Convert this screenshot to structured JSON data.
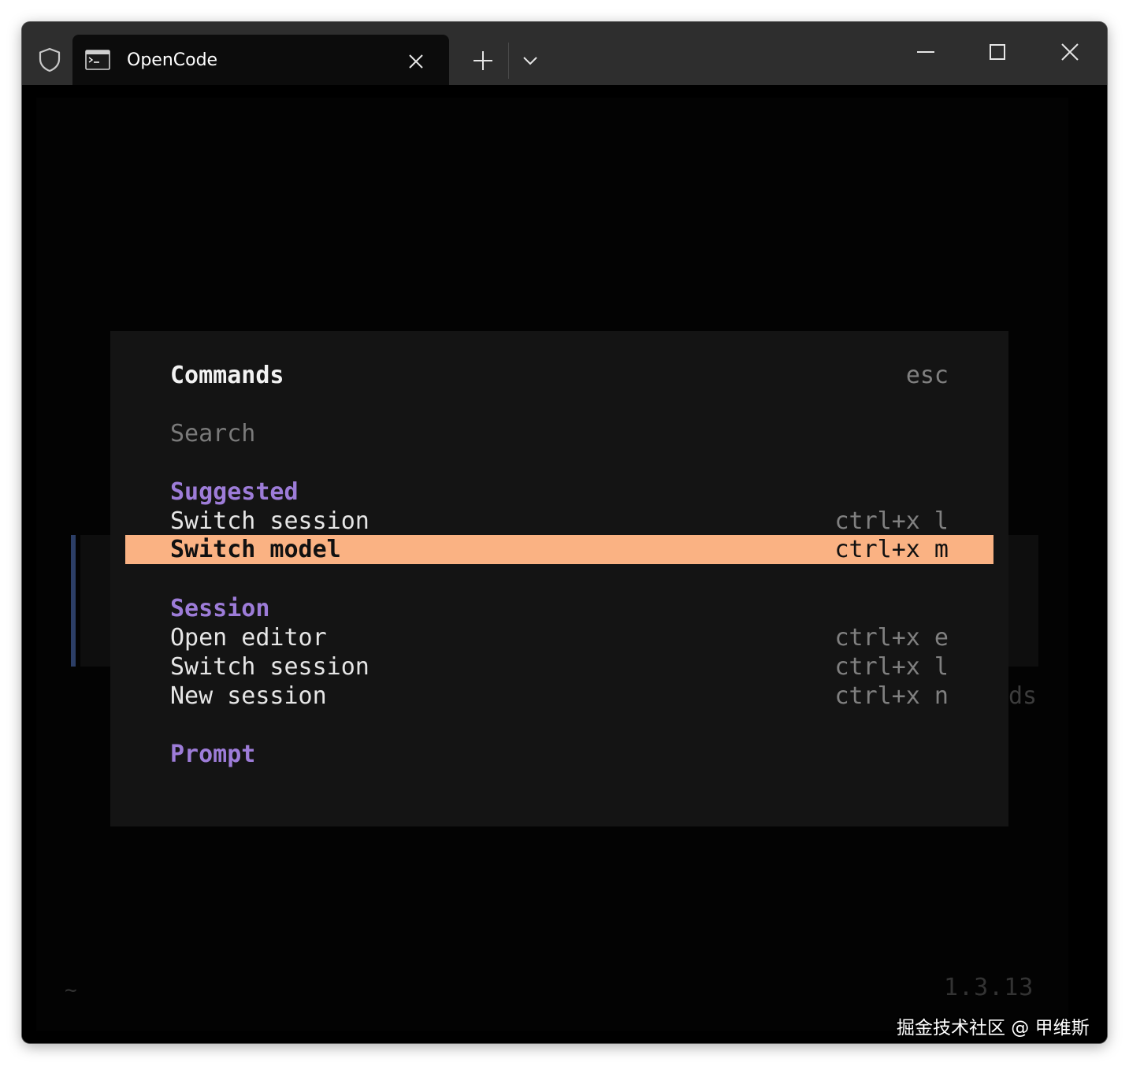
{
  "titlebar": {
    "tab_title": "OpenCode"
  },
  "terminal": {
    "background_fragment": "ds",
    "cwd": "~",
    "version": "1.3.13"
  },
  "dialog": {
    "title": "Commands",
    "dismiss_hint": "esc",
    "search_placeholder": "Search",
    "groups": [
      {
        "label": "Suggested",
        "items": [
          {
            "label": "Switch session",
            "shortcut": "ctrl+x l"
          },
          {
            "label": "Switch model",
            "shortcut": "ctrl+x m",
            "selected": true
          }
        ]
      },
      {
        "label": "Session",
        "items": [
          {
            "label": "Open editor",
            "shortcut": "ctrl+x e"
          },
          {
            "label": "Switch session",
            "shortcut": "ctrl+x l"
          },
          {
            "label": "New session",
            "shortcut": "ctrl+x n"
          }
        ]
      },
      {
        "label": "Prompt",
        "items": []
      }
    ]
  },
  "watermark": "掘金技术社区 @ 甲维斯",
  "colors": {
    "accent_group": "#9d7cd8",
    "selected_bg": "#fab283",
    "dialog_bg": "#141414"
  }
}
